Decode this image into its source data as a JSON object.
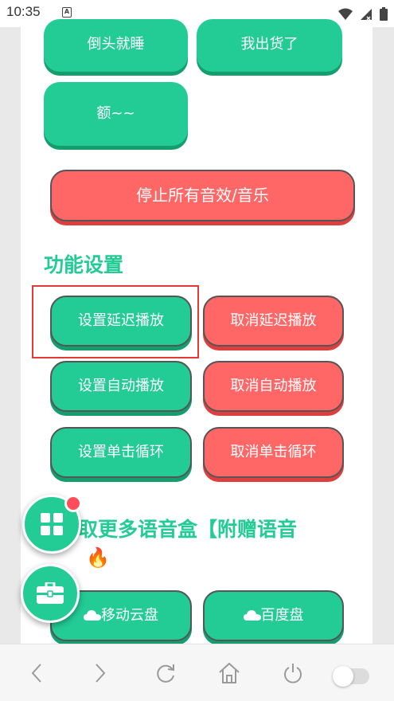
{
  "status_bar": {
    "time": "10:35",
    "notification_letter": "A"
  },
  "top_buttons": [
    {
      "label": "倒头就睡",
      "color": "#22cc94"
    },
    {
      "label": "我出货了",
      "color": "#22cc94"
    },
    {
      "label": "额~~",
      "color": "#22cc94"
    }
  ],
  "stop_all_button": {
    "label": "停止所有音效/音乐",
    "color": "#ff6767"
  },
  "settings": {
    "title": "功能设置",
    "set_delay": "设置延迟播放",
    "cancel_delay": "取消延迟播放",
    "set_auto": "设置自动播放",
    "cancel_auto": "取消自动播放",
    "set_loop": "设置单击循环",
    "cancel_loop": "取消单击循环"
  },
  "more_boxes": {
    "title": "获取更多语音盒【附赠语音",
    "title_line2_suffix": "🔥"
  },
  "download_buttons": [
    {
      "label": "移动云盘",
      "icon": "cloud-icon"
    },
    {
      "label": "百度盘",
      "icon": "cloud-icon"
    }
  ],
  "fabs": [
    {
      "icon": "grid-apps-icon",
      "has_badge": true
    },
    {
      "icon": "toolbox-icon"
    }
  ],
  "bottom_nav": {
    "items": [
      "back-icon",
      "forward-icon",
      "refresh-icon",
      "home-icon",
      "power-icon"
    ],
    "toggle_on": false
  },
  "colors": {
    "accent_green": "#22cc94",
    "accent_red": "#ff6767",
    "highlight": "#e53935",
    "badge": "#ff4d5a"
  }
}
